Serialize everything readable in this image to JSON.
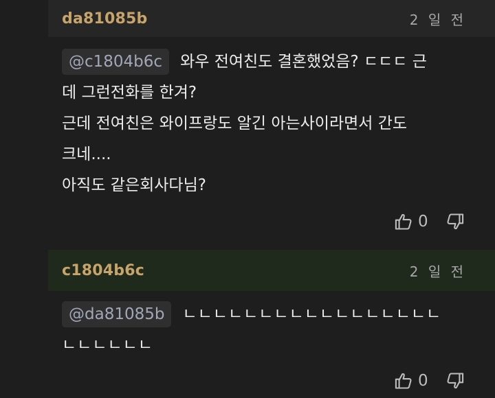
{
  "comments": [
    {
      "username": "da81085b",
      "timestamp": "2 일 전",
      "mention": "@c1804b6c",
      "lines": [
        "와우 전여친도 결혼했었음? ㄷㄷㄷ 근",
        "데 그런전화를 한겨?",
        "근데 전여친은 와이프랑도 알긴 아는사이라면서 간도",
        "크네....",
        "아직도 같은회사다님?"
      ],
      "like_count": "0",
      "like_icon": "thumbs-up-icon",
      "dislike_icon": "thumbs-down-icon"
    },
    {
      "username": "c1804b6c",
      "timestamp": "2 일 전",
      "mention": "@da81085b",
      "lines": [
        "ㄴㄴㄴㄴㄴㄴㄴㄴㄴㄴㄴㄴㄴㄴㄴㄴㄴ",
        "ㄴㄴㄴㄴㄴㄴ"
      ],
      "like_count": "0",
      "like_icon": "thumbs-up-icon",
      "dislike_icon": "thumbs-down-icon"
    }
  ],
  "colors": {
    "background": "#1e1e1e",
    "username": "#c7a56a",
    "highlighted_header": "#1f2a1c",
    "mention_bg": "#2f2f2f",
    "mention_text": "#a0a8b8"
  }
}
